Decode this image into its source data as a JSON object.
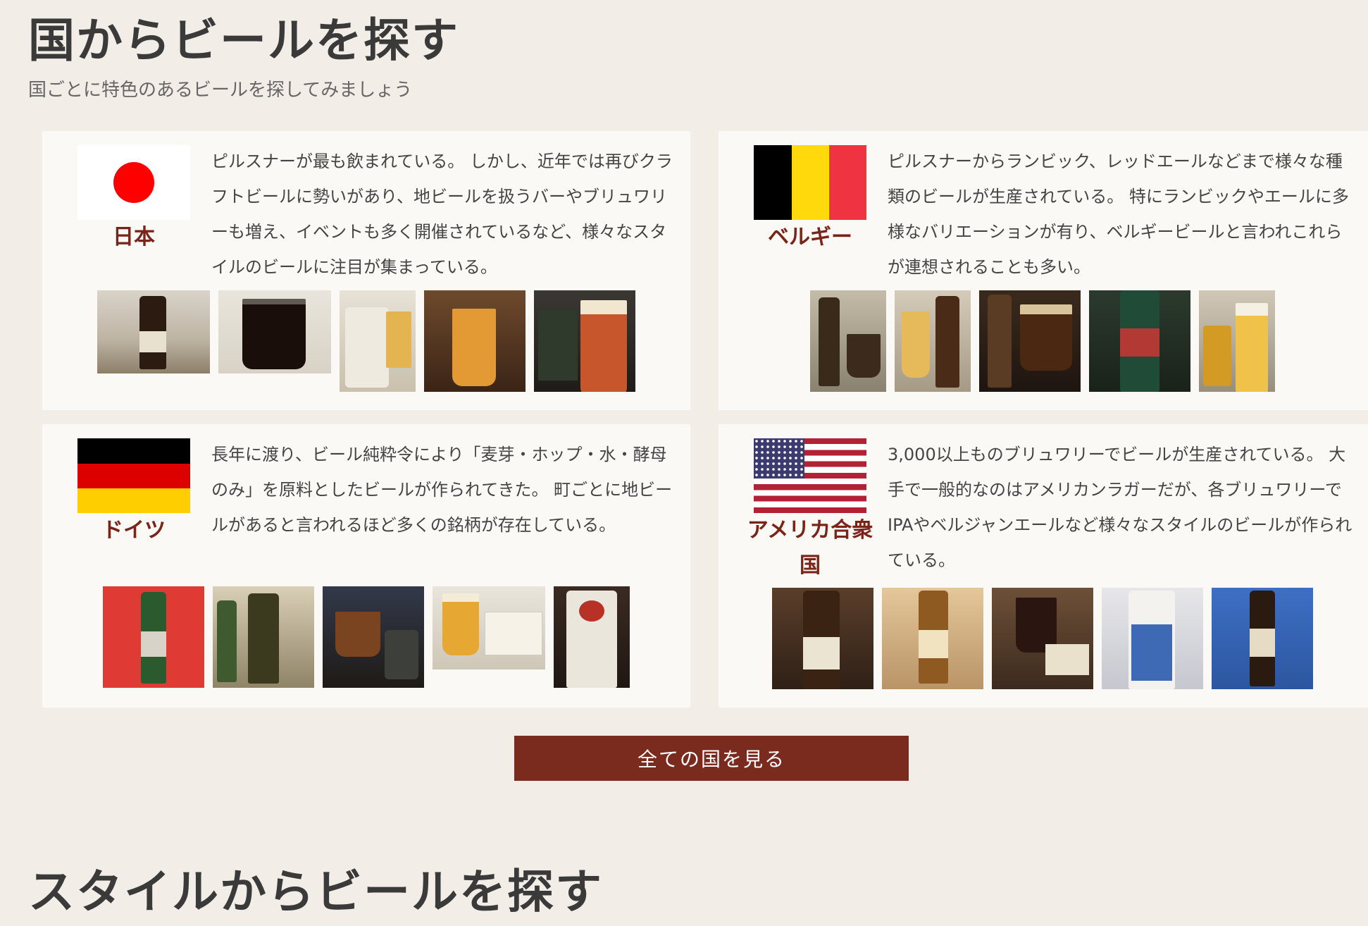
{
  "section_title": "国からビールを探す",
  "section_subtitle": "国ごとに特色のあるビールを探してみましょう",
  "countries": [
    {
      "name": "日本",
      "description": "ピルスナーが最も飲まれている。 しかし、近年では再びクラフトビールに勢いがあり、地ビールを扱うバーやブリュワリーも増え、イベントも多く開催されているなど、様々なスタイルのビールに注目が集まっている。",
      "photo_count": 5
    },
    {
      "name": "ベルギー",
      "description": "ピルスナーからランビック、レッドエールなどまで様々な種類のビールが生産されている。 特にランビックやエールに多様なバリエーションが有り、ベルギービールと言われこれらが連想されることも多い。",
      "photo_count": 5
    },
    {
      "name": "ドイツ",
      "description": "長年に渡り、ビール純粋令により「麦芽・ホップ・水・酵母のみ」を原料としたビールが作られてきた。 町ごとに地ビールがあると言われるほど多くの銘柄が存在している。",
      "photo_count": 5
    },
    {
      "name": "アメリカ合衆国",
      "description": "3,000以上ものブリュワリーでビールが生産されている。 大手で一般的なのはアメリカンラガーだが、各ブリュワリーでIPAやベルジャンエールなど様々なスタイルのビールが作られている。",
      "photo_count": 5
    }
  ],
  "view_all_button": "全ての国を見る",
  "next_section_title": "スタイルからビールを探す",
  "colors": {
    "background": "#f3ede7",
    "card": "#fbf9f6",
    "accent": "#7b2a1e",
    "country_name": "#7a2418"
  }
}
